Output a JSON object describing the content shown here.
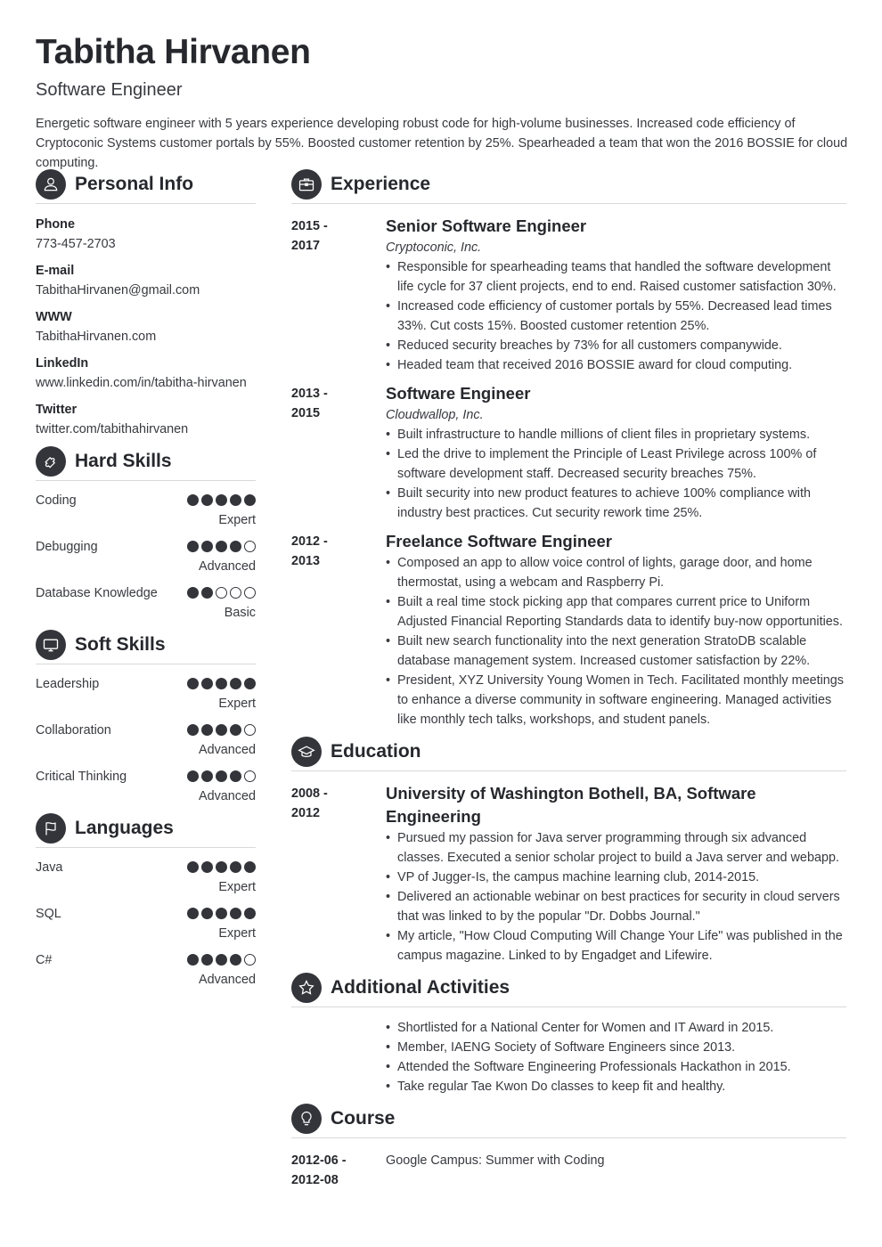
{
  "header": {
    "name": "Tabitha Hirvanen",
    "title": "Software Engineer",
    "summary": "Energetic software engineer with 5 years experience developing robust code for high-volume businesses. Increased code efficiency of Cryptoconic Systems customer portals by 55%. Boosted customer retention by 25%. Spearheaded a team that won the 2016 BOSSIE for cloud computing."
  },
  "personal_info": {
    "heading": "Personal Info",
    "icon": "user-icon",
    "items": [
      {
        "label": "Phone",
        "value": "773-457-2703"
      },
      {
        "label": "E-mail",
        "value": "TabithaHirvanen@gmail.com"
      },
      {
        "label": "WWW",
        "value": "TabithaHirvanen.com"
      },
      {
        "label": "LinkedIn",
        "value": "www.linkedin.com/in/tabitha-hirvanen"
      },
      {
        "label": "Twitter",
        "value": "twitter.com/tabithahirvanen"
      }
    ]
  },
  "hard_skills": {
    "heading": "Hard Skills",
    "icon": "puzzle-icon",
    "items": [
      {
        "name": "Coding",
        "level": "Expert",
        "rating": 5,
        "max": 5
      },
      {
        "name": "Debugging",
        "level": "Advanced",
        "rating": 4,
        "max": 5
      },
      {
        "name": "Database Knowledge",
        "level": "Basic",
        "rating": 2,
        "max": 5
      }
    ]
  },
  "soft_skills": {
    "heading": "Soft Skills",
    "icon": "monitor-icon",
    "items": [
      {
        "name": "Leadership",
        "level": "Expert",
        "rating": 5,
        "max": 5
      },
      {
        "name": "Collaboration",
        "level": "Advanced",
        "rating": 4,
        "max": 5
      },
      {
        "name": "Critical Thinking",
        "level": "Advanced",
        "rating": 4,
        "max": 5
      }
    ]
  },
  "languages": {
    "heading": "Languages",
    "icon": "flag-icon",
    "items": [
      {
        "name": "Java",
        "level": "Expert",
        "rating": 5,
        "max": 5
      },
      {
        "name": "SQL",
        "level": "Expert",
        "rating": 5,
        "max": 5
      },
      {
        "name": "C#",
        "level": "Advanced",
        "rating": 4,
        "max": 5
      }
    ]
  },
  "experience": {
    "heading": "Experience",
    "icon": "briefcase-icon",
    "items": [
      {
        "date_start": "2015 -",
        "date_end": "2017",
        "title": "Senior Software Engineer",
        "company": "Cryptoconic, Inc.",
        "bullets": [
          "Responsible for spearheading teams that handled the software development life cycle for 37 client projects, end to end. Raised customer satisfaction 30%.",
          "Increased code efficiency of customer portals by 55%. Decreased lead times 33%. Cut costs 15%. Boosted customer retention 25%.",
          "Reduced security breaches by 73% for all customers companywide.",
          "Headed team that received 2016 BOSSIE award for cloud computing."
        ]
      },
      {
        "date_start": "2013 -",
        "date_end": "2015",
        "title": "Software Engineer",
        "company": "Cloudwallop, Inc.",
        "bullets": [
          "Built infrastructure to handle millions of client files in proprietary systems.",
          "Led the drive to implement the Principle of Least Privilege across 100% of software development staff. Decreased security breaches 75%.",
          "Built security into new product features to achieve 100% compliance with industry best practices. Cut security rework time 25%."
        ]
      },
      {
        "date_start": "2012 -",
        "date_end": "2013",
        "title": "Freelance Software Engineer",
        "company": "",
        "bullets": [
          "Composed an app to allow voice control of lights, garage door, and home thermostat, using a webcam and Raspberry Pi.",
          "Built a real time stock picking app that compares current price to Uniform Adjusted Financial Reporting Standards data to identify buy-now opportunities.",
          "Built new search functionality into the next generation StratoDB scalable database management system. Increased customer satisfaction by 22%.",
          "President, XYZ University Young Women in Tech. Facilitated monthly meetings to enhance a diverse community in software engineering. Managed activities like monthly tech talks, workshops, and student panels."
        ]
      }
    ]
  },
  "education": {
    "heading": "Education",
    "icon": "graduation-cap-icon",
    "items": [
      {
        "date_start": "2008 -",
        "date_end": "2012",
        "title": "University of Washington Bothell, BA, Software Engineering",
        "bullets": [
          "Pursued my passion for Java server programming through six advanced classes. Executed a senior scholar project to build a Java server and webapp.",
          "VP of Jugger-Is, the campus machine learning club, 2014-2015.",
          "Delivered an actionable webinar on best practices for security in cloud servers that was linked to by the popular \"Dr. Dobbs Journal.\"",
          "My article, \"How Cloud Computing Will Change Your Life\" was published in the campus magazine. Linked to by Engadget and Lifewire."
        ]
      }
    ]
  },
  "activities": {
    "heading": "Additional Activities",
    "icon": "star-icon",
    "bullets": [
      "Shortlisted for a National Center for Women and IT Award in 2015.",
      "Member, IAENG Society of Software Engineers since 2013.",
      "Attended the Software Engineering Professionals Hackathon in 2015.",
      "Take regular Tae Kwon Do classes to keep fit and healthy."
    ]
  },
  "course": {
    "heading": "Course",
    "icon": "lightbulb-icon",
    "items": [
      {
        "date_start": "2012-06 -",
        "date_end": "2012-08",
        "text": "Google Campus: Summer with Coding"
      }
    ]
  },
  "colors": {
    "icon_bg": "#33353a",
    "heading_text": "#26282d",
    "body_text": "#383a3f",
    "divider": "#d9d9d9"
  }
}
